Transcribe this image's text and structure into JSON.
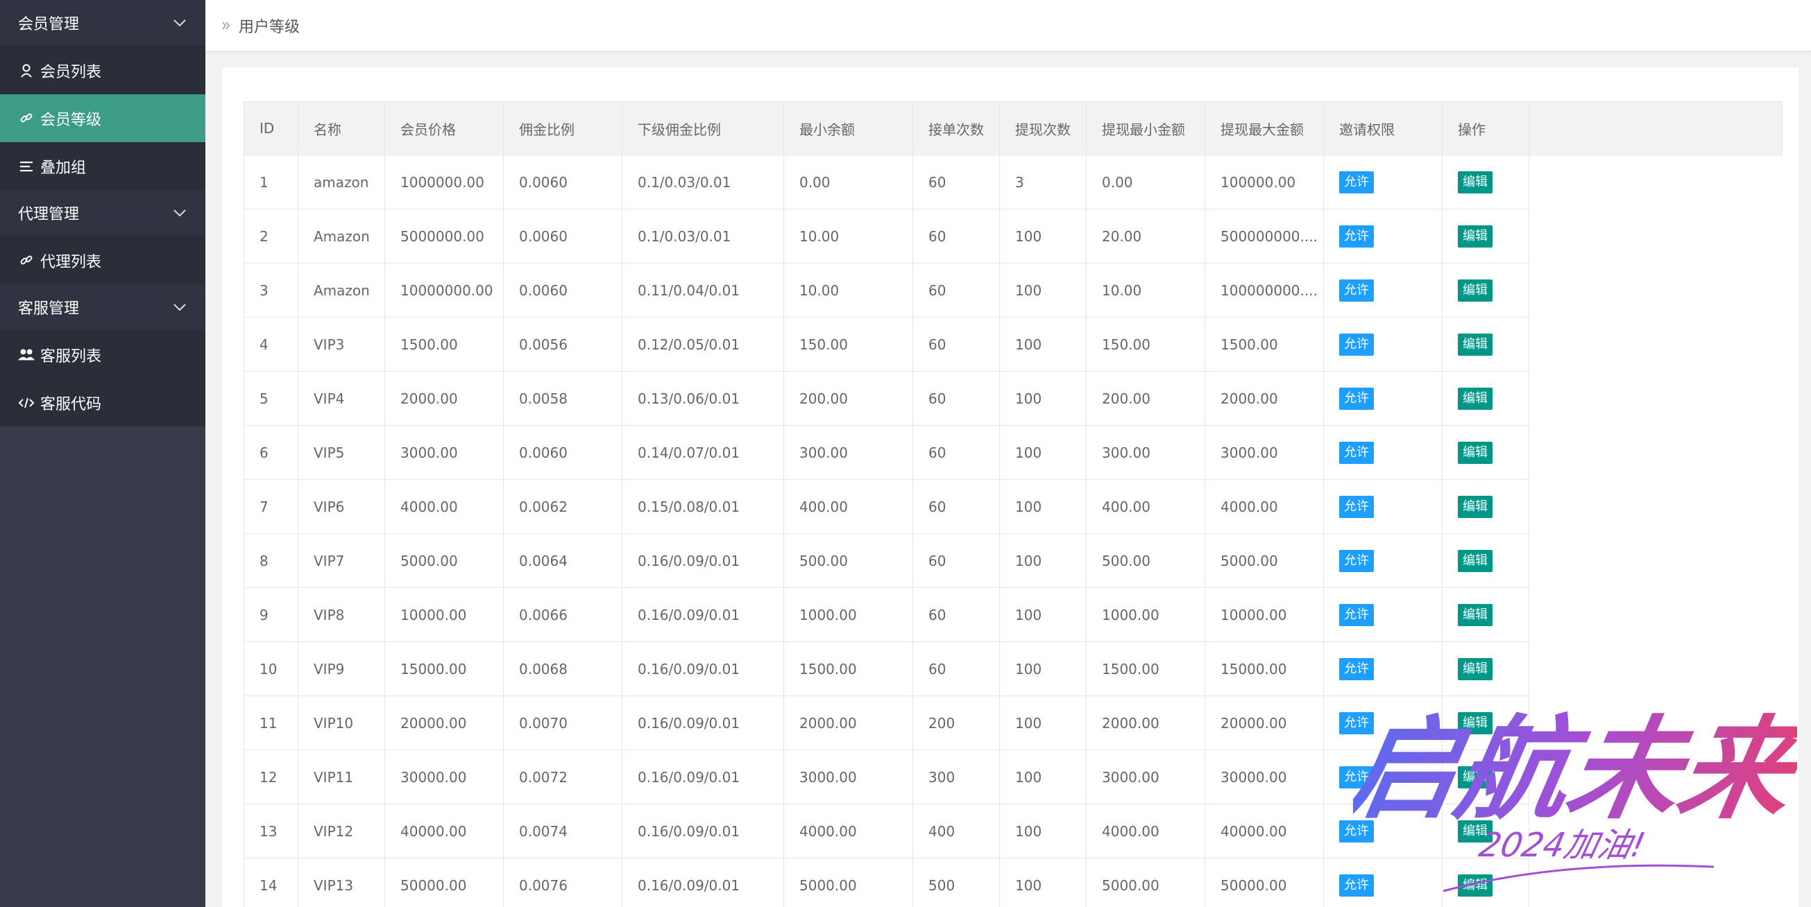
{
  "sidebar": {
    "groups": [
      {
        "label": "会员管理",
        "items": [
          {
            "label": "会员列表",
            "icon": "user-icon"
          },
          {
            "label": "会员等级",
            "icon": "link-icon",
            "active": true
          },
          {
            "label": "叠加组",
            "icon": "list-icon"
          }
        ]
      },
      {
        "label": "代理管理",
        "items": [
          {
            "label": "代理列表",
            "icon": "link-icon"
          }
        ]
      },
      {
        "label": "客服管理",
        "items": [
          {
            "label": "客服列表",
            "icon": "users-icon"
          },
          {
            "label": "客服代码",
            "icon": "code-icon"
          }
        ]
      }
    ]
  },
  "header": {
    "breadcrumb": "用户等级"
  },
  "table": {
    "columns": [
      "ID",
      "名称",
      "会员价格",
      "佣金比例",
      "下级佣金比例",
      "最小余额",
      "接单次数",
      "提现次数",
      "提现最小金额",
      "提现最大金额",
      "邀请权限",
      "操作"
    ],
    "rows": [
      [
        "1",
        "amazon",
        "1000000.00",
        "0.0060",
        "0.1/0.03/0.01",
        "0.00",
        "60",
        "3",
        "0.00",
        "100000.00"
      ],
      [
        "2",
        "Amazon",
        "5000000.00",
        "0.0060",
        "0.1/0.03/0.01",
        "10.00",
        "60",
        "100",
        "20.00",
        "500000000...."
      ],
      [
        "3",
        "Amazon",
        "10000000.00",
        "0.0060",
        "0.11/0.04/0.01",
        "10.00",
        "60",
        "100",
        "10.00",
        "100000000...."
      ],
      [
        "4",
        "VIP3",
        "1500.00",
        "0.0056",
        "0.12/0.05/0.01",
        "150.00",
        "60",
        "100",
        "150.00",
        "1500.00"
      ],
      [
        "5",
        "VIP4",
        "2000.00",
        "0.0058",
        "0.13/0.06/0.01",
        "200.00",
        "60",
        "100",
        "200.00",
        "2000.00"
      ],
      [
        "6",
        "VIP5",
        "3000.00",
        "0.0060",
        "0.14/0.07/0.01",
        "300.00",
        "60",
        "100",
        "300.00",
        "3000.00"
      ],
      [
        "7",
        "VIP6",
        "4000.00",
        "0.0062",
        "0.15/0.08/0.01",
        "400.00",
        "60",
        "100",
        "400.00",
        "4000.00"
      ],
      [
        "8",
        "VIP7",
        "5000.00",
        "0.0064",
        "0.16/0.09/0.01",
        "500.00",
        "60",
        "100",
        "500.00",
        "5000.00"
      ],
      [
        "9",
        "VIP8",
        "10000.00",
        "0.0066",
        "0.16/0.09/0.01",
        "1000.00",
        "60",
        "100",
        "1000.00",
        "10000.00"
      ],
      [
        "10",
        "VIP9",
        "15000.00",
        "0.0068",
        "0.16/0.09/0.01",
        "1500.00",
        "60",
        "100",
        "1500.00",
        "15000.00"
      ],
      [
        "11",
        "VIP10",
        "20000.00",
        "0.0070",
        "0.16/0.09/0.01",
        "2000.00",
        "200",
        "100",
        "2000.00",
        "20000.00"
      ],
      [
        "12",
        "VIP11",
        "30000.00",
        "0.0072",
        "0.16/0.09/0.01",
        "3000.00",
        "300",
        "100",
        "3000.00",
        "30000.00"
      ],
      [
        "13",
        "VIP12",
        "40000.00",
        "0.0074",
        "0.16/0.09/0.01",
        "4000.00",
        "400",
        "100",
        "4000.00",
        "40000.00"
      ],
      [
        "14",
        "VIP13",
        "50000.00",
        "0.0076",
        "0.16/0.09/0.01",
        "5000.00",
        "500",
        "100",
        "5000.00",
        "50000.00"
      ]
    ],
    "allow_label": "允许",
    "edit_label": "编辑"
  },
  "watermark": {
    "text": "启航未来",
    "subtext": "2024加油!"
  },
  "colors": {
    "sidebar_bg": "#393d49",
    "active_item": "#3d9c86",
    "allow_button": "#1e9fff",
    "edit_button": "#009688"
  }
}
